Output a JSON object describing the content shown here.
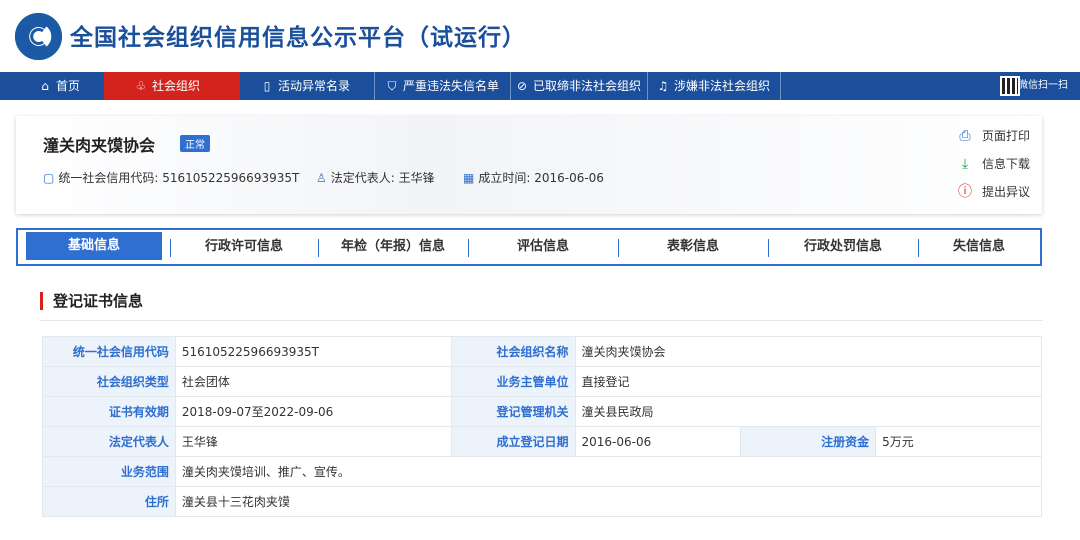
{
  "header": {
    "title": "全国社会组织信用信息公示平台（试运行）"
  },
  "nav": {
    "items": [
      {
        "icon": "home-icon",
        "glyph": "⌂",
        "label": "首页"
      },
      {
        "icon": "org-tree-icon",
        "glyph": "♧",
        "label": "社会组织"
      },
      {
        "icon": "clipboard-icon",
        "glyph": "▯",
        "label": "活动异常名录"
      },
      {
        "icon": "shield-icon",
        "glyph": "⛉",
        "label": "严重违法失信名单"
      },
      {
        "icon": "ban-icon",
        "glyph": "⊘",
        "label": "已取缔非法社会组织"
      },
      {
        "icon": "bell-icon",
        "glyph": "♫",
        "label": "涉嫌非法社会组织"
      }
    ],
    "qr_label": "微信扫一扫"
  },
  "org": {
    "name": "潼关肉夹馍协会",
    "status": "正常",
    "credit_code_label": "统一社会信用代码: 51610522596693935T",
    "legal_rep_label": "法定代表人: 王华锋",
    "founded_label": "成立时间: 2016-06-06",
    "actions": [
      {
        "icon": "printer-icon",
        "glyph": "⎙",
        "label": "页面打印"
      },
      {
        "icon": "download-icon",
        "glyph": "⤓",
        "label": "信息下载"
      },
      {
        "icon": "info-icon",
        "glyph": "ⓘ",
        "label": "提出异议"
      }
    ]
  },
  "tabs": [
    "基础信息",
    "行政许可信息",
    "年检（年报）信息",
    "评估信息",
    "表彰信息",
    "行政处罚信息",
    "失信信息"
  ],
  "section": {
    "title": "登记证书信息"
  },
  "table": {
    "r1": {
      "k1": "统一社会信用代码",
      "v1": "51610522596693935T",
      "k2": "社会组织名称",
      "v2": "潼关肉夹馍协会"
    },
    "r2": {
      "k1": "社会组织类型",
      "v1": "社会团体",
      "k2": "业务主管单位",
      "v2": "直接登记"
    },
    "r3": {
      "k1": "证书有效期",
      "v1": "2018-09-07至2022-09-06",
      "k2": "登记管理机关",
      "v2": "潼关县民政局"
    },
    "r4": {
      "k1": "法定代表人",
      "v1": "王华锋",
      "k2": "成立登记日期",
      "v2": "2016-06-06",
      "k3": "注册资金",
      "v3": "5万元"
    },
    "r5": {
      "k1": "业务范围",
      "v1": "潼关肉夹馍培训、推广、宣传。"
    },
    "r6": {
      "k1": "住所",
      "v1": "潼关县十三花肉夹馍"
    }
  },
  "colors": {
    "brand_blue": "#1b4f9c",
    "accent_blue": "#2f6fd0",
    "active_red": "#d4231d"
  }
}
